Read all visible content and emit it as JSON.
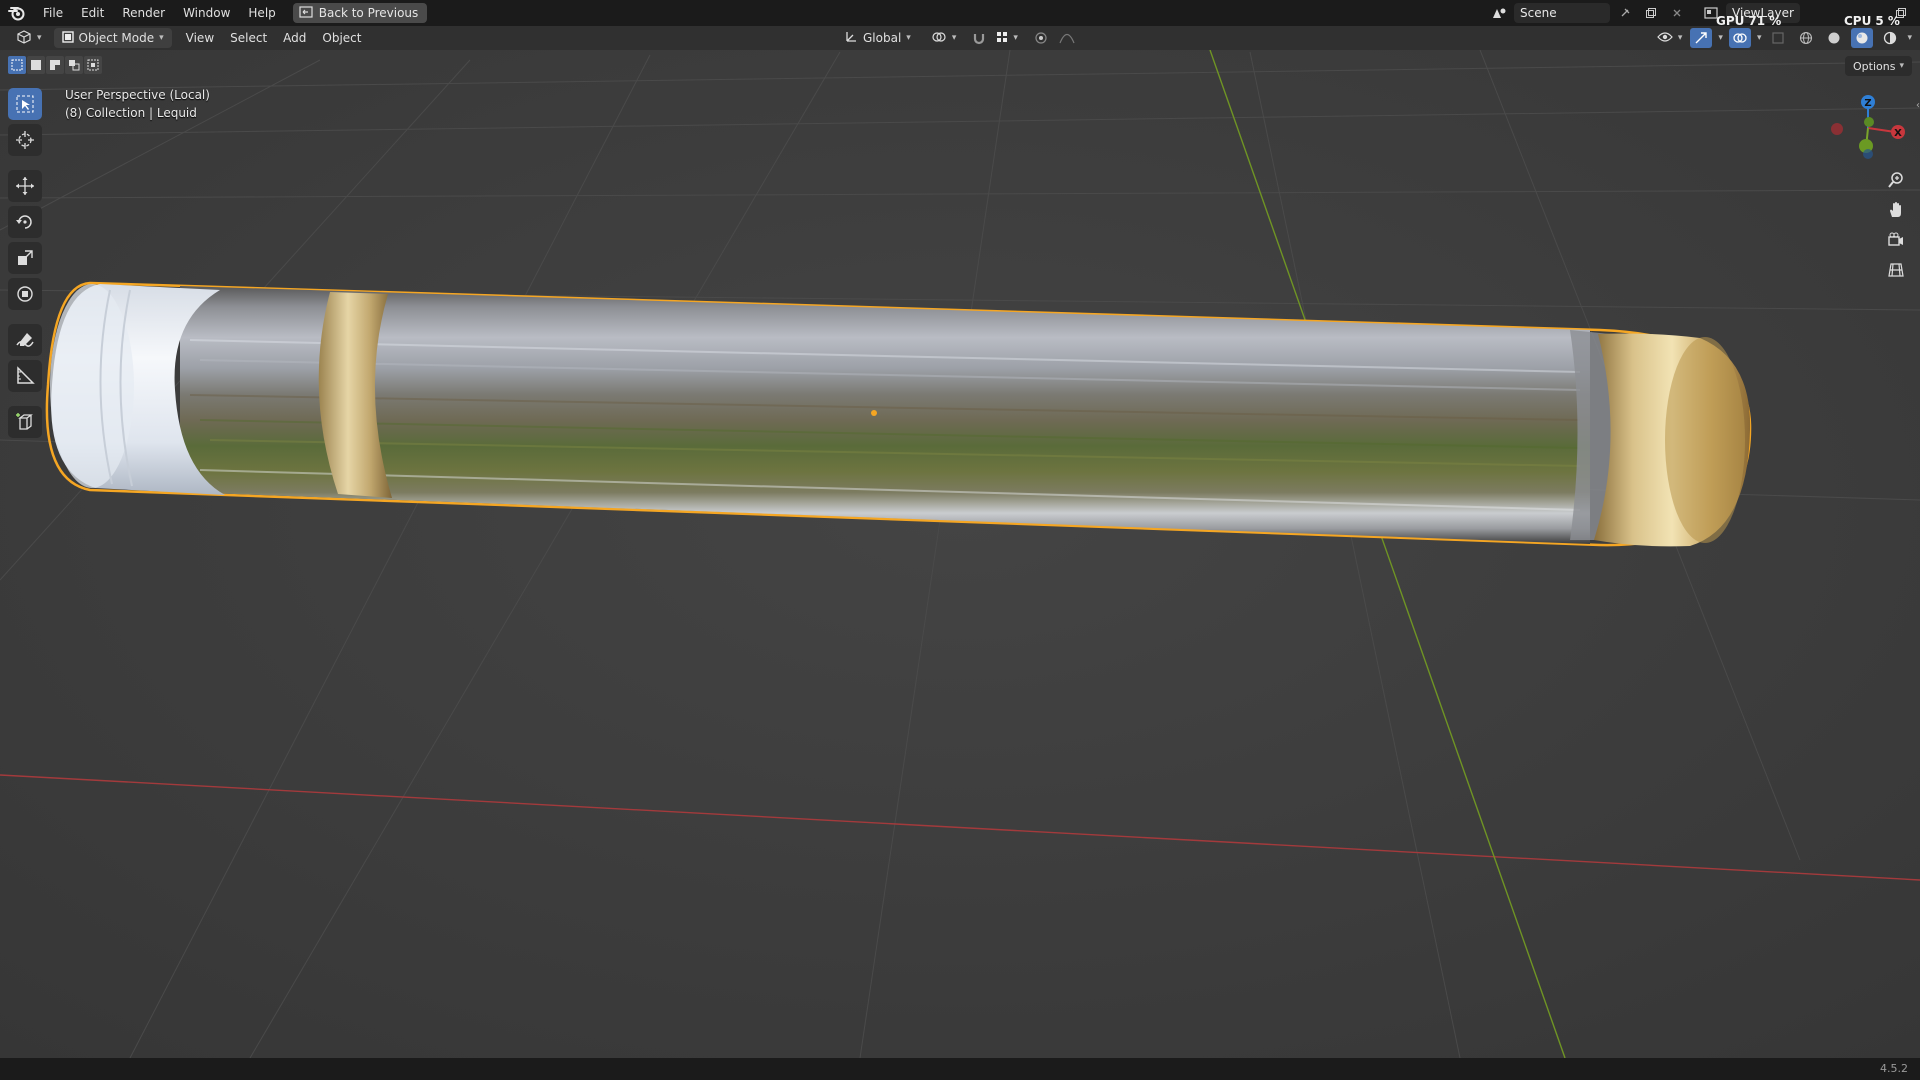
{
  "topbar": {
    "menus": [
      "File",
      "Edit",
      "Render",
      "Window",
      "Help"
    ],
    "back_label": "Back to Previous",
    "scene": "Scene",
    "view_layer": "ViewLayer",
    "gpu_label": "GPU",
    "gpu_value": "71 %",
    "cpu_label": "CPU",
    "cpu_value": "5 %"
  },
  "header": {
    "mode": "Object Mode",
    "menus": [
      "View",
      "Select",
      "Add",
      "Object"
    ],
    "orientation": "Global"
  },
  "viewport": {
    "perspective": "User Perspective (Local)",
    "collection": "(8) Collection | Lequid",
    "options_label": "Options",
    "gizmo_axes": [
      "Z",
      "X"
    ]
  },
  "status": {
    "version": "4.5.2"
  },
  "colors": {
    "accent": "#4772b3",
    "selection_outline": "#f5a623",
    "x_axis": "#c8373d",
    "y_axis": "#7aa52b",
    "z_axis": "#2f7fd6"
  }
}
